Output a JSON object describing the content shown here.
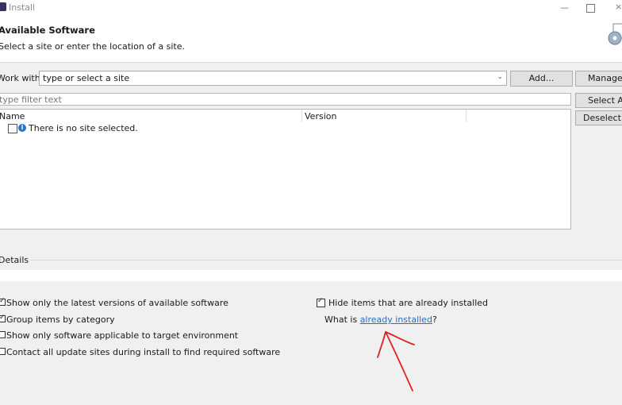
{
  "window": {
    "title": "Install",
    "min_glyph": "—",
    "close_glyph": "×"
  },
  "header": {
    "title": "Available Software",
    "subtitle": "Select a site or enter the location of a site."
  },
  "work_with": {
    "label": "Work with:",
    "value": "type or select a site",
    "add_button": "Add...",
    "manage_button": "Manage..."
  },
  "filter": {
    "placeholder": "type filter text"
  },
  "table": {
    "columns": [
      "Name",
      "Version"
    ],
    "empty_message": "There is no site selected."
  },
  "side_buttons": {
    "select_all": "Select All",
    "deselect_all": "Deselect All"
  },
  "details": {
    "label": "Details"
  },
  "options": {
    "latest_versions": {
      "label": "Show only the latest versions of available software",
      "checked": true
    },
    "group_by_category": {
      "label": "Group items by category",
      "checked": true
    },
    "target_env": {
      "label": "Show only software applicable to target environment",
      "checked": false
    },
    "contact_all": {
      "label": "Contact all update sites during install to find required software",
      "checked": false
    },
    "hide_installed": {
      "label": "Hide items that are already installed",
      "checked": true
    },
    "what_is_prefix": "What is ",
    "what_is_link": "already installed",
    "what_is_suffix": "?"
  },
  "colors": {
    "link": "#2a6cc2",
    "annotation": "#e02020"
  }
}
